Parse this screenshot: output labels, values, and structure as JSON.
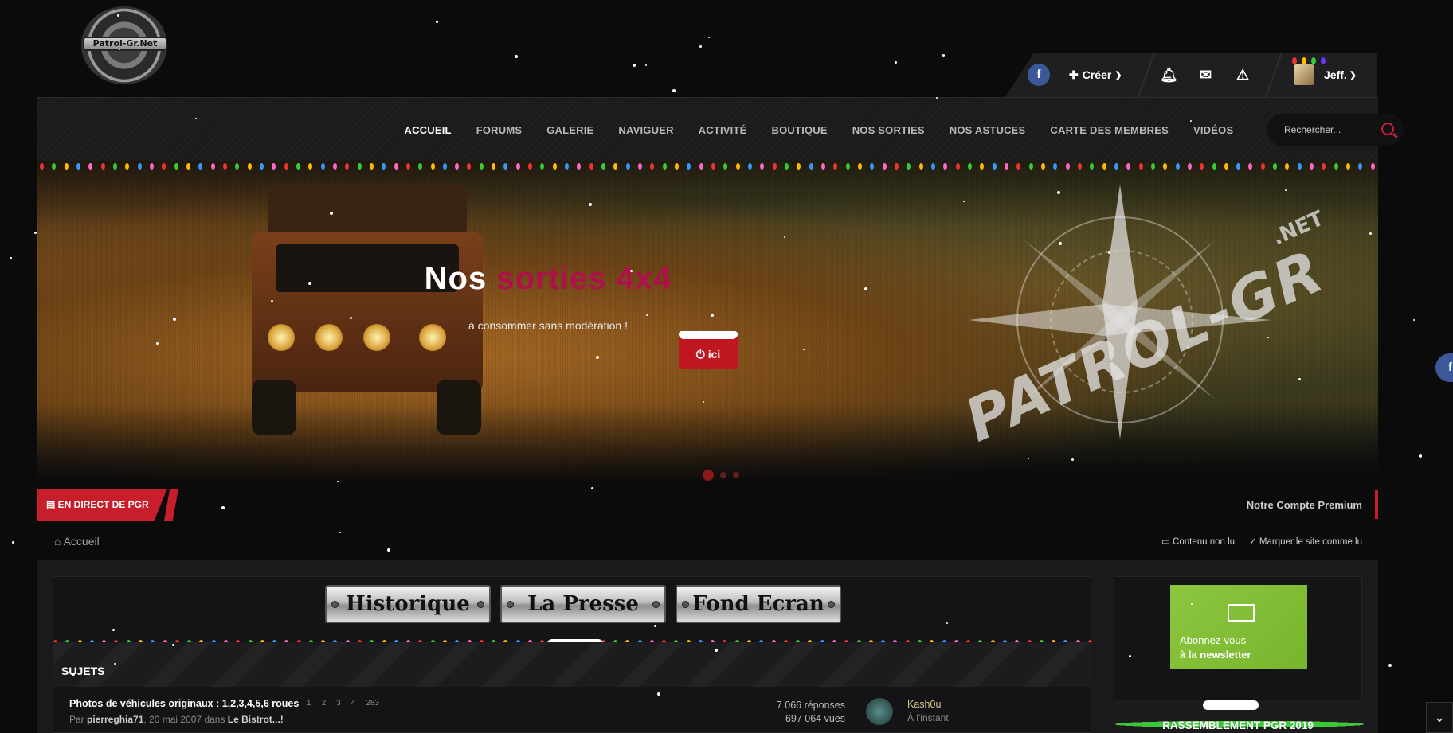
{
  "logo": {
    "text": "Patrol-Gr.Net"
  },
  "userbar": {
    "facebook_icon": "f",
    "create_label": "Créer",
    "user_name": "Jeff."
  },
  "nav": {
    "items": [
      "ACCUEIL",
      "FORUMS",
      "GALERIE",
      "NAVIGUER",
      "ACTIVITÉ",
      "BOUTIQUE",
      "NOS SORTIES",
      "NOS ASTUCES",
      "CARTE DES MEMBRES",
      "VIDÉOS"
    ],
    "active": "ACCUEIL"
  },
  "search": {
    "placeholder": "Rechercher..."
  },
  "hero": {
    "title_plain": "Nos ",
    "title_accent": "sorties 4x4",
    "subtitle": "à consommer sans modération !",
    "button_label": "ici",
    "watermark": "PATROL-GR",
    "watermark_net": ".NET",
    "accent_color": "#b0104a"
  },
  "livebar": {
    "label": "EN DIRECT DE PGR",
    "premium": "Notre Compte Premium"
  },
  "breadcrumb": {
    "home": "Accueil",
    "unread": "Contenu non lu",
    "mark_read": "Marquer le site comme lu"
  },
  "plaques": [
    "Historique",
    "La Presse",
    "Fond Ecran"
  ],
  "section": {
    "title": "SUJETS"
  },
  "topic": {
    "title": "Photos de véhicules originaux : 1,2,3,4,5,6 roues",
    "pages": [
      "1",
      "2",
      "3",
      "4",
      "283"
    ],
    "meta_prefix": "Par ",
    "author": "pierreghia71",
    "meta_date": ", 20 mai 2007 dans ",
    "forum": "Le Bistrot...!",
    "replies": "7 066 réponses",
    "views": "697 064 vues",
    "last_poster": "Kash0u",
    "last_time": "À l'instant"
  },
  "sidebar": {
    "newsletter_line1": "Abonnez-vous",
    "newsletter_line2": "à la newsletter",
    "rassemblement": "RASSEMBLEMENT PGR 2019"
  },
  "colors": {
    "brand_red": "#c81e2b",
    "facebook": "#3b5998",
    "newsletter_green": "#8dc63f"
  }
}
